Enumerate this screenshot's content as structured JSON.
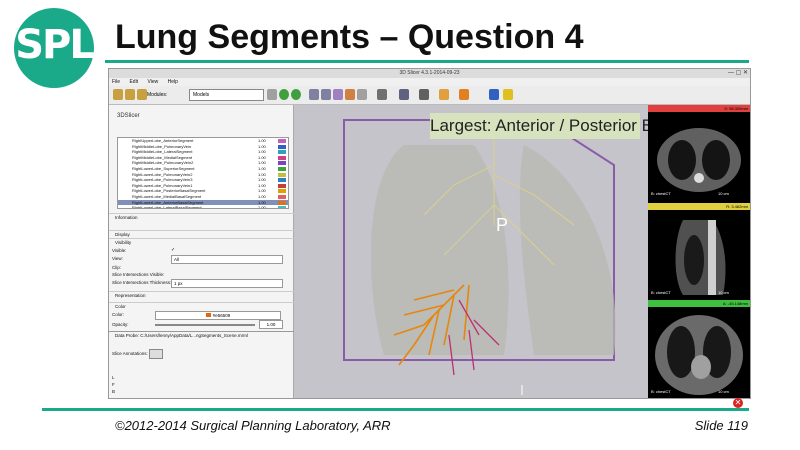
{
  "slide": {
    "logo_text": "SPL",
    "title": "Lung Segments – Question 4",
    "copyright": "©2012-2014 Surgical Planning Laboratory, ARR",
    "slide_number": "Slide 119",
    "accent_color": "#1aaa8a"
  },
  "app": {
    "window_title": "3D Slicer 4.3.1-2014-09-23",
    "menu": [
      "File",
      "Edit",
      "View",
      "Help"
    ],
    "modules_label": "Modules:",
    "module_selected": "Models",
    "panel_logo": "3DSlicer"
  },
  "models": [
    {
      "name": "RightUpperLobe_AnteriorSegment",
      "opacity": "1.00",
      "color": "#c060c0"
    },
    {
      "name": "RightMiddleLobe_PulmonaryVein",
      "opacity": "1.00",
      "color": "#3060c0"
    },
    {
      "name": "RightMiddleLobe_LateralSegment",
      "opacity": "1.00",
      "color": "#30a0c0"
    },
    {
      "name": "RightMiddleLobe_MedialSegment",
      "opacity": "1.00",
      "color": "#d04080"
    },
    {
      "name": "RightMiddleLobe_PulmonaryVein2",
      "opacity": "1.00",
      "color": "#8040c0"
    },
    {
      "name": "RightLowerLobe_SuperiorSegment",
      "opacity": "1.00",
      "color": "#40a040"
    },
    {
      "name": "RightLowerLobe_PulmonaryVein2",
      "opacity": "1.00",
      "color": "#c0c040"
    },
    {
      "name": "RightLowerLobe_PulmonaryVein3",
      "opacity": "1.00",
      "color": "#3080c0"
    },
    {
      "name": "RightLowerLobe_PulmonaryVein1",
      "opacity": "1.00",
      "color": "#c04040"
    },
    {
      "name": "RightLowerLobe_PosteriorBasalSegment",
      "opacity": "1.00",
      "color": "#e0a000"
    },
    {
      "name": "RightLowerLobe_MedialBasalSegment",
      "opacity": "1.00",
      "color": "#e06060"
    },
    {
      "name": "RightLowerLobe_AnteriorBasalSegment",
      "opacity": "1.00",
      "color": "#e07020"
    },
    {
      "name": "RightLowerLobe_LateralBasalSegment",
      "opacity": "1.00",
      "color": "#40c0c0"
    },
    {
      "name": "RightLowerLobe_PulmonaryVein4",
      "opacity": "1.00",
      "color": "#6060e0"
    }
  ],
  "panel": {
    "information": "Information",
    "display": "Display",
    "visibility": "Visibility",
    "visible_label": "Visible:",
    "view_label": "View:",
    "view_value": "All",
    "clip_label": "Clip:",
    "slice_int_label": "Slice Intersections Visible:",
    "slice_thick_label": "Slice Intersections Thickness:",
    "slice_thick_value": "1 px",
    "representation": "Representation",
    "color_section": "Color",
    "color_label": "Color:",
    "color_value": "#e56509",
    "opacity_label": "Opacity:",
    "opacity_value": "1.00",
    "data_probe": "Data Probe: C:/Users/lenny/AppData/L...ngSegments_Scene.mrml",
    "slice_annotations": "Slice Annotations:",
    "probe_letters": [
      "L",
      "F",
      "B"
    ]
  },
  "view3d": {
    "answer": "Largest: Anterior / Posterior Basal",
    "orientation_label": "P"
  },
  "slices": [
    {
      "bar_color": "#e04040",
      "readout": "S: 98.300mm",
      "volume": "B: chestCT",
      "scale": "10 cm"
    },
    {
      "bar_color": "#e0d040",
      "readout": "R: 3.462mm",
      "volume": "B: chestCT",
      "scale": "10 cm"
    },
    {
      "bar_color": "#40c040",
      "readout": "A: -45.148mm",
      "volume": "B: chestCT",
      "scale": "10 cm"
    }
  ]
}
